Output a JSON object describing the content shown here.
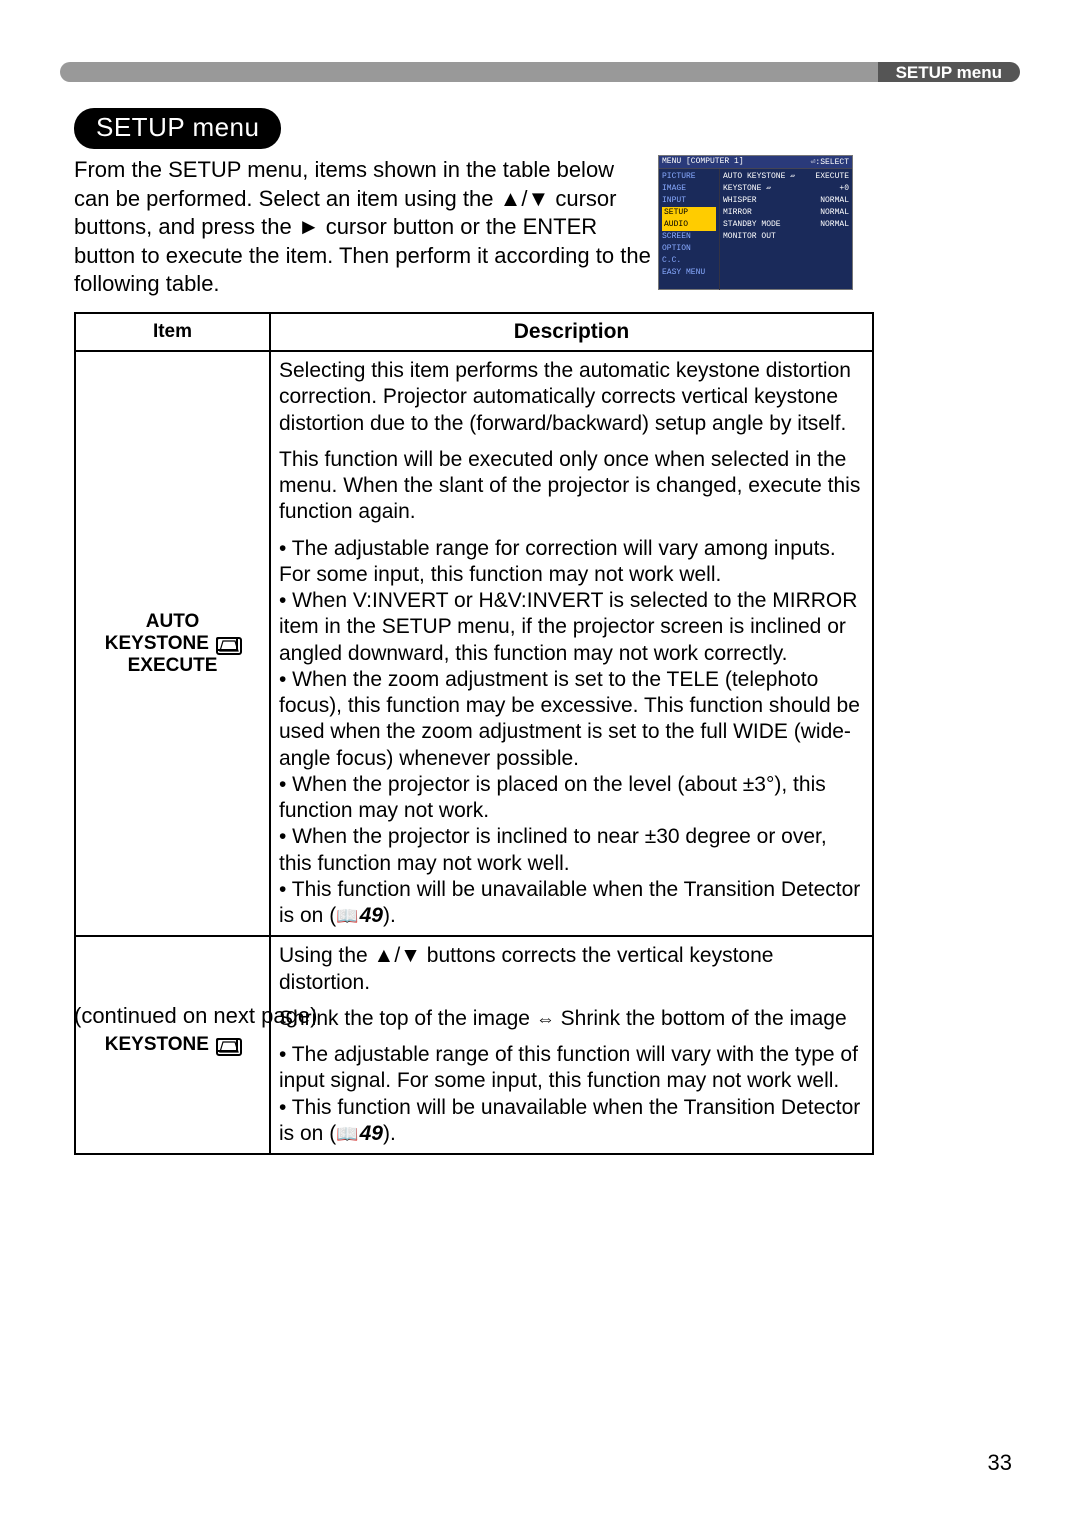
{
  "header": {
    "label": "SETUP menu"
  },
  "section_title": "SETUP menu",
  "intro": "From the SETUP menu, items shown in the table below can be performed.\nSelect an item using the ▲/▼ cursor buttons, and press the ► cursor button or the ENTER button to execute the item. Then perform it according to the following table.",
  "menushot": {
    "top_left": "MENU [COMPUTER 1]",
    "top_right": "⏎:SELECT",
    "left": [
      "PICTURE",
      "IMAGE",
      "INPUT",
      "SETUP",
      "AUDIO",
      "SCREEN",
      "OPTION",
      "C.C.",
      "EASY MENU"
    ],
    "right": [
      {
        "l": "AUTO KEYSTONE ▱",
        "r": "EXECUTE"
      },
      {
        "l": "KEYSTONE ▱",
        "r": "+0"
      },
      {
        "l": "WHISPER",
        "r": "NORMAL"
      },
      {
        "l": "MIRROR",
        "r": "NORMAL"
      },
      {
        "l": "STANDBY MODE",
        "r": "NORMAL"
      },
      {
        "l": "MONITOR OUT",
        "r": ""
      }
    ]
  },
  "table": {
    "head_item": "Item",
    "head_desc": "Description",
    "rows": [
      {
        "item_lines": [
          "AUTO",
          "KEYSTONE",
          "EXECUTE"
        ],
        "has_keystone_icon_after_line": 1,
        "desc_paragraphs": [
          "Selecting this item performs the automatic keystone distortion correction. Projector automatically corrects vertical keystone distortion due to the (forward/backward) setup angle by itself.",
          "This function will be executed only once when selected in the menu. When the slant of the projector is changed, execute this function again.",
          "• The adjustable range for correction will vary among inputs. For some input, this function may not work well.\n• When V:INVERT or H&V:INVERT is selected to the MIRROR item in the SETUP menu, if the projector screen is inclined or angled downward, this function may not work correctly.\n• When the zoom adjustment is set to the TELE (telephoto focus), this function may be excessive. This function should be used when the zoom adjustment is set to the full WIDE (wide-angle focus) whenever possible.\n• When the projector is placed on the level (about ±3°), this function may not work.\n• When the projector is inclined to near ±30 degree or over, this function may not work well.\n• This function will be unavailable when the Transition Detector is on (📖49)."
        ]
      },
      {
        "item_lines": [
          "KEYSTONE"
        ],
        "has_keystone_icon_after_line": 0,
        "desc_paragraphs": [
          "Using the ▲/▼ buttons corrects the vertical keystone distortion.",
          "Shrink the top of the image ⇔ Shrink the bottom of the image",
          "• The adjustable range of this function will vary with the type of input signal. For some input, this function may not work well.\n• This function will be unavailable when the Transition Detector is on (📖49)."
        ]
      }
    ]
  },
  "continued": "(continued on next page)",
  "pagenum": "33",
  "ref49": "49"
}
